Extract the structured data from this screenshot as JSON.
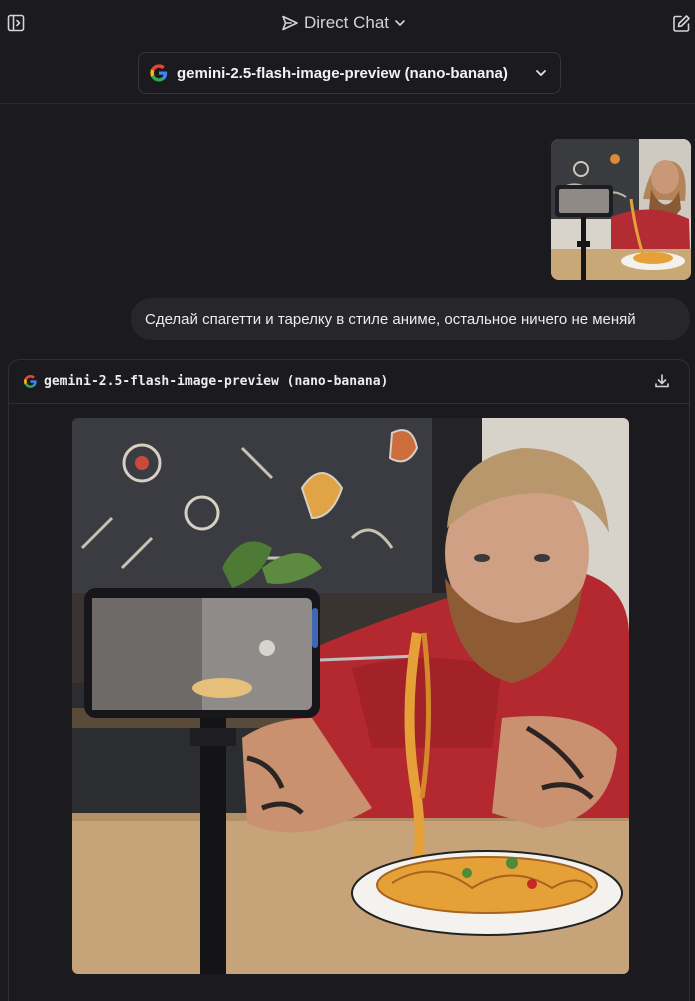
{
  "header": {
    "mode_label": "Direct Chat",
    "model_selector_label": "gemini-2.5-flash-image-preview (nano-banana)"
  },
  "user_message": {
    "text": "Сделай спагетти и тарелку в стиле аниме, остальное ничего не меняй"
  },
  "response": {
    "model_label": "gemini-2.5-flash-image-preview (nano-banana)"
  },
  "colors": {
    "background": "#1b1b1f",
    "bubble": "#26262b",
    "border": "#2f2f35",
    "text": "#e8e8ea"
  },
  "icons": {
    "sidebar": "sidebar-toggle-icon",
    "mode": "send-paper-plane-icon",
    "new_chat": "edit-new-chat-icon",
    "provider": "google-g-icon",
    "download": "download-icon"
  }
}
